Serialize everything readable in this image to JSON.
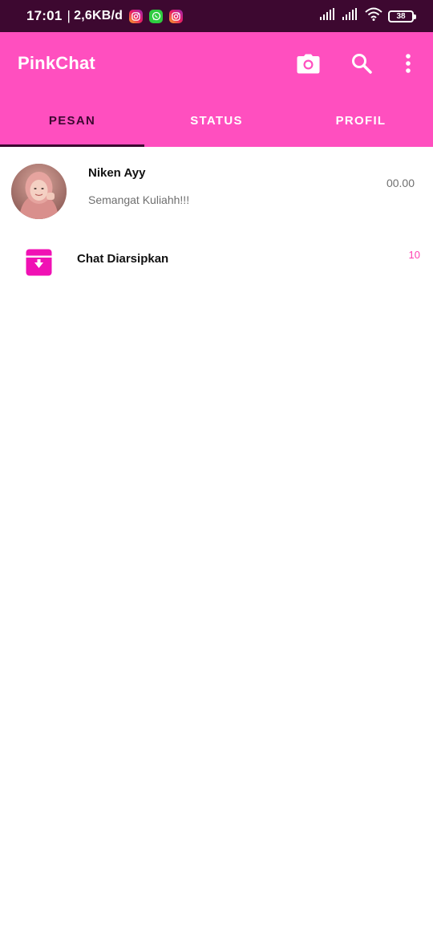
{
  "status_bar": {
    "time": "17:01",
    "separator": "|",
    "speed": "2,6KB/d",
    "battery": "38"
  },
  "app_bar": {
    "title": "PinkChat"
  },
  "tabs": [
    {
      "label": "PESAN",
      "active": true
    },
    {
      "label": "STATUS",
      "active": false
    },
    {
      "label": "PROFIL",
      "active": false
    }
  ],
  "chats": [
    {
      "name": "Niken Ayy",
      "message": "Semangat Kuliahh!!!",
      "time": "00.00"
    }
  ],
  "archived": {
    "label": "Chat Diarsipkan",
    "count": "10"
  },
  "colors": {
    "primary": "#ff4fbf",
    "status_bar": "#3d0830",
    "accent": "#ff40b0",
    "archive_icon": "#f011b4"
  }
}
